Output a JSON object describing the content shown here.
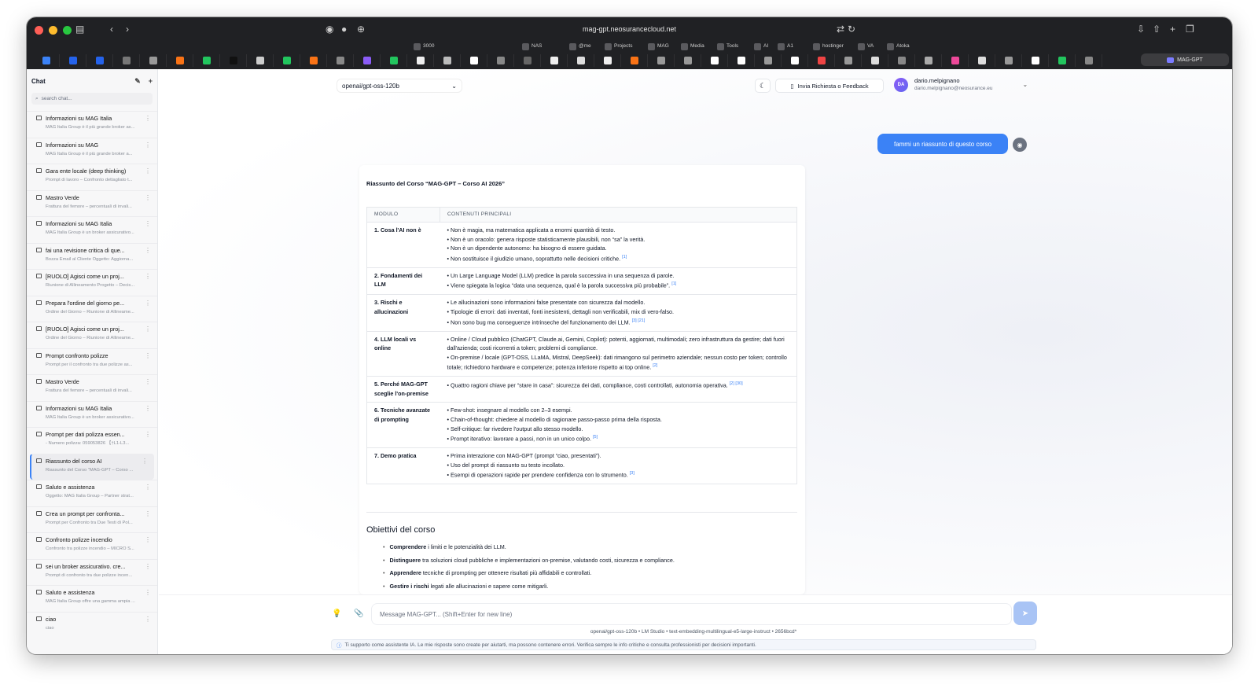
{
  "browser": {
    "url": "mag-gpt.neosurancecloud.net",
    "bookmarks": [
      "3000",
      "NAS",
      "@me",
      "Projects",
      "MAG",
      "Media",
      "Tools",
      "AI",
      "A1",
      "hostinger",
      "VA",
      "Atoka"
    ],
    "active_tab": "MAG-GPT"
  },
  "sidebar": {
    "title": "Chat",
    "search_placeholder": "search chat...",
    "chats": [
      {
        "title": "Informazioni su MAG Italia",
        "snippet": "MAG Italia Group è il più grande broker as..."
      },
      {
        "title": "Informazioni su MAG",
        "snippet": "MAG Italia Group è il più grande broker a..."
      },
      {
        "title": "Gara ente locale (deep thinking)",
        "snippet": "Prompt di lavoro – Confronto dettagliato t..."
      },
      {
        "title": "Mastro Verde",
        "snippet": "Frattura del femore – percentuali di invali..."
      },
      {
        "title": "Informazioni su MAG Italia",
        "snippet": "MAG Italia Group è un broker assicurativo..."
      },
      {
        "title": "fai una revisione critica di que...",
        "snippet": "Bozza Email al Cliente Oggetto: Aggiorna..."
      },
      {
        "title": "[RUOLO] Agisci come un proj...",
        "snippet": "Riunione di Allineamento Progetto – Decis..."
      },
      {
        "title": "Prepara l'ordine del giorno pe...",
        "snippet": "Ordine del Giorno – Riunione di Allineame..."
      },
      {
        "title": "[RUOLO] Agisci come un proj...",
        "snippet": "Ordine del Giorno – Riunione di Allineame..."
      },
      {
        "title": "Prompt confronto polizze",
        "snippet": "Prompt per il confronto tra due polizze as..."
      },
      {
        "title": "Mastro Verde",
        "snippet": "Frattura del femore – percentuali di invali..."
      },
      {
        "title": "Informazioni su MAG Italia",
        "snippet": "MAG Italia Group è un broker assicurativo..."
      },
      {
        "title": "Prompt per dati polizza essen...",
        "snippet": "- Numero polizza: 059053826 【†L1-L3..."
      },
      {
        "title": "Riassunto del corso AI",
        "snippet": "Riassunto del Corso \"MAG-GPT – Corso ..."
      },
      {
        "title": "Saluto e assistenza",
        "snippet": "Oggetto: MAG Italia Group – Partner strat..."
      },
      {
        "title": "Crea un prompt per confronta...",
        "snippet": "Prompt per Confronto tra Due Testi di Pol..."
      },
      {
        "title": "Confronto polizze incendio",
        "snippet": "Confronto tra polizze incendio – MICRO S..."
      },
      {
        "title": "sei un broker assicurativo. cre...",
        "snippet": "Prompt di confronto tra due polizze incen..."
      },
      {
        "title": "Saluto e assistenza",
        "snippet": "MAG Italia Group offre una gamma ampia ..."
      },
      {
        "title": "ciao",
        "snippet": "ciao"
      }
    ]
  },
  "header": {
    "model": "openai/gpt-oss-120b",
    "feedback_label": "Invia Richiesta o Feedback",
    "user_initials": "DA",
    "user_name": "dario.melpignano",
    "user_email": "dario.melpignano@neosurance.eu"
  },
  "conversation": {
    "user_message": "fammi un riassunto di questo corso",
    "response_title": "Riassunto del Corso “MAG-GPT – Corso AI 2026”",
    "table_headers": [
      "MODULO",
      "CONTENUTI PRINCIPALI"
    ],
    "modules": [
      {
        "name": "1. Cosa l'AI non è",
        "lines": [
          {
            "text": "• Non è magia, ma matematica applicata a enormi quantità di testo."
          },
          {
            "text": "• Non è un oracolo: genera risposte statisticamente plausibili, non “sa” la verità."
          },
          {
            "text": "• Non è un dipendente autonomo: ha bisogno di essere guidata."
          },
          {
            "text": "• Non sostituisce il giudizio umano, soprattutto nelle decisioni critiche.",
            "ref": "[1]"
          }
        ]
      },
      {
        "name": "2. Fondamenti dei LLM",
        "lines": [
          {
            "text": "• Un Large Language Model (LLM) predice la parola successiva in una sequenza di parole."
          },
          {
            "text": "• Viene spiegata la logica “data una sequenza, qual è la parola successiva più probabile”.",
            "ref": "[1]"
          }
        ]
      },
      {
        "name": "3. Rischi e allucinazioni",
        "lines": [
          {
            "text": "• Le allucinazioni sono informazioni false presentate con sicurezza dal modello."
          },
          {
            "text": "• Tipologie di errori: dati inventati, fonti inesistenti, dettagli non verificabili, mix di vero-falso."
          },
          {
            "text": "• Non sono bug ma conseguenze intrinseche del funzionamento dei LLM.",
            "ref": "[3] [21]"
          }
        ]
      },
      {
        "name": "4. LLM locali vs online",
        "lines": [
          {
            "text": "• Online / Cloud pubblico (ChatGPT, Claude.ai, Gemini, Copilot): potenti, aggiornati, multimodali; zero infrastruttura da gestire; dati fuori dall'azienda; costi ricorrenti a token; problemi di compliance.",
            "wrap": true
          },
          {
            "text": "• On-premise / locale (GPT-OSS, LLaMA, Mistral, DeepSeek): dati rimangono sul perimetro aziendale; nessun costo per token; controllo totale; richiedono hardware e competenze; potenza inferiore rispetto ai top online.",
            "ref": "[2]",
            "wrap": true
          }
        ]
      },
      {
        "name": "5. Perché MAG-GPT sceglie l'on-premise",
        "lines": [
          {
            "text": "• Quattro ragioni chiave per “stare in casa”: sicurezza dei dati, compliance, costi controllati, autonomia operativa.",
            "ref": "[2] [30]",
            "wrap": true
          }
        ]
      },
      {
        "name": "6. Tecniche avanzate di prompting",
        "lines": [
          {
            "text": "• Few-shot: insegnare al modello con 2–3 esempi."
          },
          {
            "text": "• Chain-of-thought: chiedere al modello di ragionare passo-passo prima della risposta."
          },
          {
            "text": "• Self-critique: far rivedere l'output allo stesso modello."
          },
          {
            "text": "• Prompt iterativo: lavorare a passi, non in un unico colpo.",
            "ref": "[5]"
          }
        ]
      },
      {
        "name": "7. Demo pratica",
        "lines": [
          {
            "text": "• Prima interazione con MAG-GPT (prompt “ciao, presentati”)."
          },
          {
            "text": "• Uso del prompt di riassunto su testo incollato."
          },
          {
            "text": "• Esempi di operazioni rapide per prendere confidenza con lo strumento.",
            "ref": "[3]"
          }
        ]
      }
    ],
    "objectives_title": "Obiettivi del corso",
    "objectives": [
      {
        "bold": "Comprendere",
        "rest": " i limiti e le potenzialità dei LLM."
      },
      {
        "bold": "Distinguere",
        "rest": " tra soluzioni cloud pubbliche e implementazioni on-premise, valutando costi, sicurezza e compliance."
      },
      {
        "bold": "Apprendere",
        "rest": " tecniche di prompting per ottenere risultati più affidabili e controllati."
      },
      {
        "bold": "Gestire i rischi",
        "rest": " legati alle allucinazioni e sapere come mitigarli."
      }
    ]
  },
  "composer": {
    "placeholder": "Message MAG-GPT... (Shift+Enter for new line)",
    "meta": "openai/gpt-oss-120b • LM Studio • text-embedding-multilingual-e5-large-instruct • 2656bcd*",
    "disclaimer": "Ti supporto come assistente IA. Le mie risposte sono create per aiutarti, ma possono contenere errori. Verifica sempre le info critiche e consulta professionisti per decisioni importanti."
  },
  "colors": {
    "accent": "#3b82f6",
    "titlebar": "#202124",
    "sidebar": "#f7f7f8",
    "send_disabled": "#a9c4f5"
  }
}
